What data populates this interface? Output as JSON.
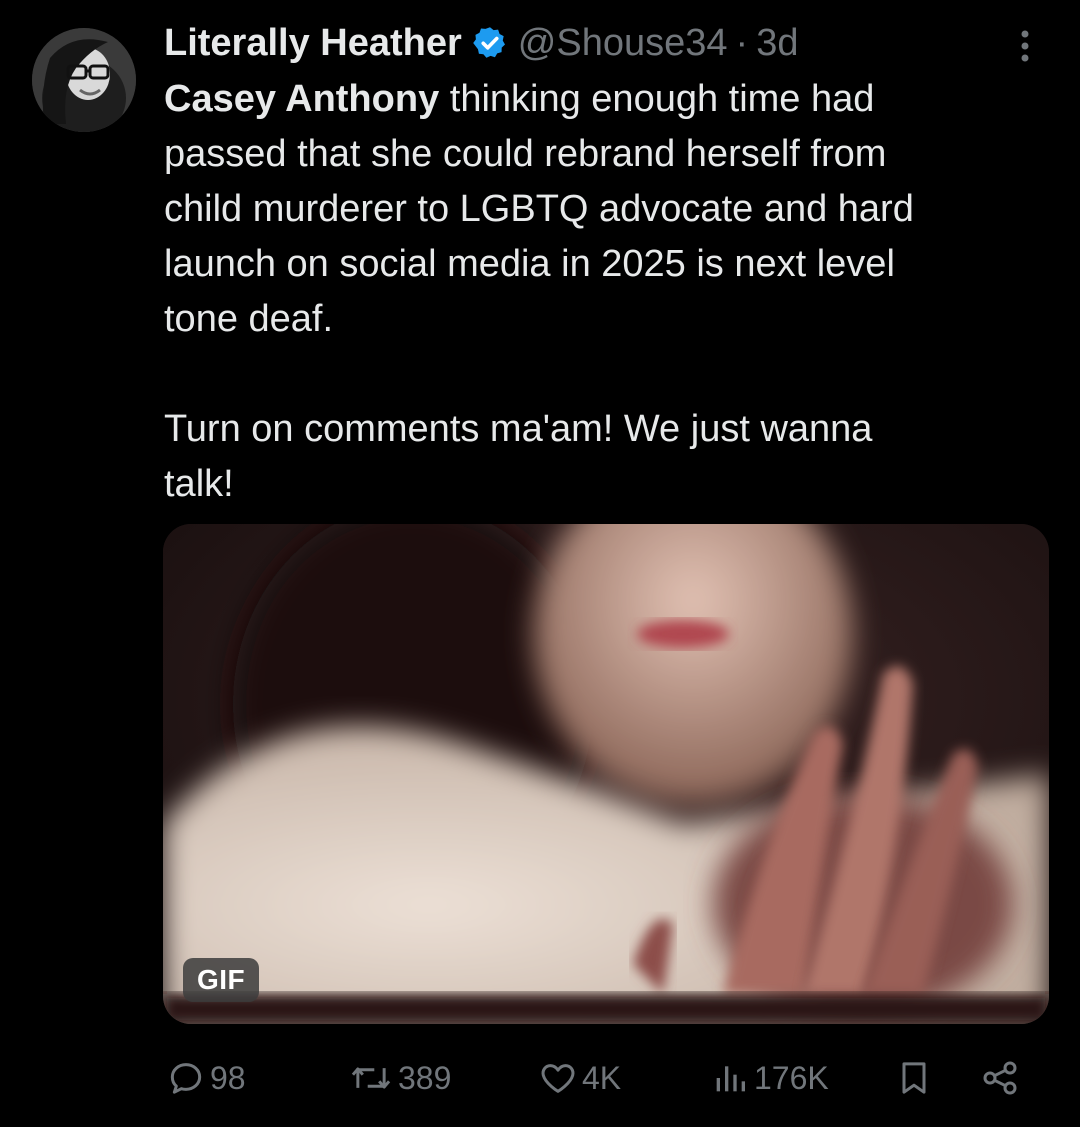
{
  "tweet": {
    "author_name": "Literally Heather",
    "handle": "@Shouse34",
    "separator": "·",
    "time": "3d",
    "avatar_icon": "avatar-photo",
    "verified_icon": "verified-badge-icon",
    "text_bold": "Casey Anthony",
    "text_rest": " thinking enough time had\npassed that she could rebrand herself from\nchild murderer to LGBTQ advocate and hard\nlaunch on social media in 2025 is next level\ntone deaf.\n\nTurn on comments ma'am! We just wanna\ntalk!",
    "media": {
      "type": "GIF",
      "badge_label": "GIF"
    }
  },
  "actions": {
    "reply_count": "98",
    "retweet_count": "389",
    "like_count": "4K",
    "views_count": "176K"
  },
  "colors": {
    "background": "#000000",
    "text": "#e7e9ea",
    "muted": "#71767b",
    "verified": "#1d9bf0"
  }
}
